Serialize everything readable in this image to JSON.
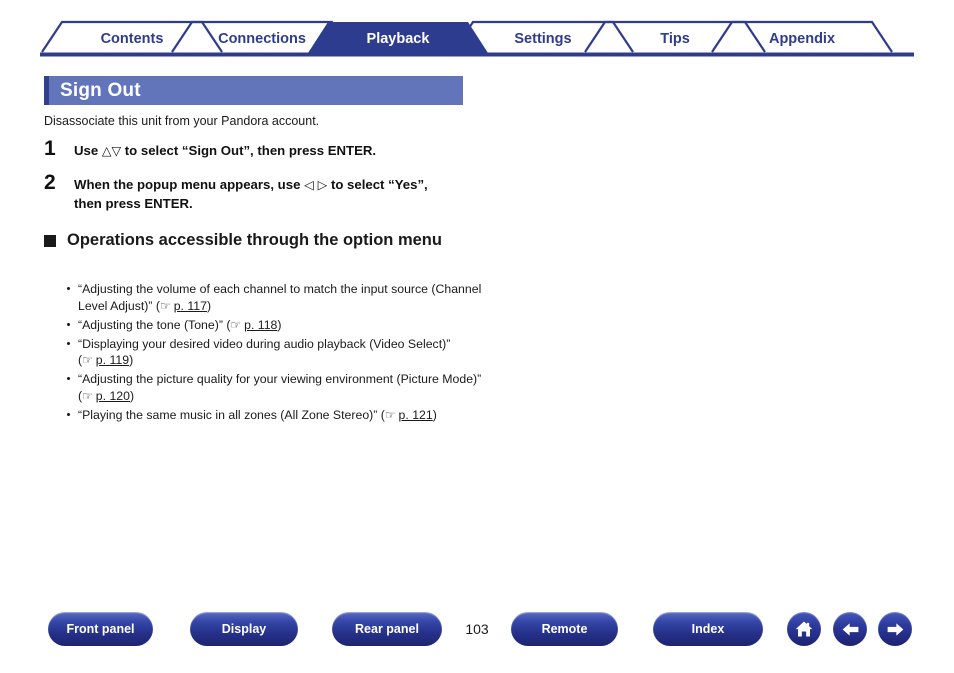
{
  "tabs": [
    {
      "label": "Contents",
      "active": false
    },
    {
      "label": "Connections",
      "active": false
    },
    {
      "label": "Playback",
      "active": true
    },
    {
      "label": "Settings",
      "active": false
    },
    {
      "label": "Tips",
      "active": false
    },
    {
      "label": "Appendix",
      "active": false
    }
  ],
  "section": {
    "title": "Sign Out",
    "intro": "Disassociate this unit from your Pandora account."
  },
  "steps": [
    {
      "num": "1",
      "pre": "Use ",
      "glyph": "△▽",
      "post": " to select “Sign Out”, then press ENTER."
    },
    {
      "num": "2",
      "pre": "When the popup menu appears, use ",
      "glyph": "◁ ▷",
      "post": " to select “Yes”, then press ENTER."
    }
  ],
  "subhead": {
    "text": "Operations accessible through the option menu"
  },
  "bullets": [
    {
      "text": "“Adjusting the volume of each channel to match the input source (Channel Level Adjust)” (",
      "icon": "pointing-hand-icon",
      "page": "p. 117",
      "tail": ")"
    },
    {
      "text": "“Adjusting the tone (Tone)” (",
      "icon": "pointing-hand-icon",
      "page": "p. 118",
      "tail": ")"
    },
    {
      "text": "“Displaying your desired video during audio playback (Video Select)” (",
      "icon": "pointing-hand-icon",
      "page": "p. 119",
      "tail": ")"
    },
    {
      "text": "“Adjusting the picture quality for your viewing environment (Picture Mode)” (",
      "icon": "pointing-hand-icon",
      "page": "p. 120",
      "tail": ")"
    },
    {
      "text": "“Playing the same music in all zones (All Zone Stereo)” (",
      "icon": "pointing-hand-icon",
      "page": "p. 121",
      "tail": ")"
    }
  ],
  "footer": {
    "buttons": [
      {
        "label": "Front panel"
      },
      {
        "label": "Display"
      },
      {
        "label": "Rear panel"
      },
      {
        "label": "Remote"
      },
      {
        "label": "Index"
      }
    ],
    "page_number": "103",
    "icons": [
      {
        "name": "home-icon"
      },
      {
        "name": "arrow-left-icon"
      },
      {
        "name": "arrow-right-icon"
      }
    ]
  },
  "colors": {
    "tab_navy": "#2f3c8e",
    "tab_active_bg": "#2e3c8f",
    "header_bg": "#6274ba",
    "header_accent": "#33408f",
    "button_blue": "#2d3a9c",
    "text": "#1a1a1a"
  }
}
